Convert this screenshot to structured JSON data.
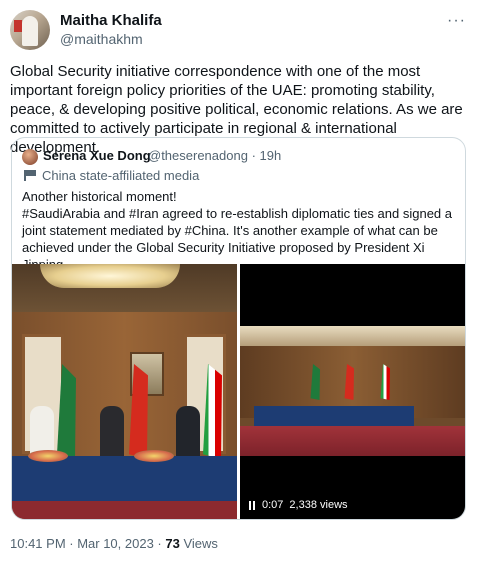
{
  "tweet": {
    "author_name": "Maitha Khalifa",
    "author_handle": "@maithakhm",
    "text": "Global Security initiative correspondence with one of the most important foreign policy priorities of the UAE: promoting stability, peace, & developing positive political, economic relations. As we are committed to actively participate in regional & international development.",
    "more_glyph": "···"
  },
  "quoted": {
    "author_name": "Serena Xue Dong",
    "author_handle": "@theserenadong",
    "time": "· 19h",
    "label": "China state-affiliated media",
    "text": "Another historical moment!\n#SaudiArabia and #Iran agreed to re-establish diplomatic ties and signed a joint statement mediated by #China. It's another example of what can be achieved under the Global Security Initiative proposed by President Xi Jinping.",
    "video": {
      "time": "0:07",
      "views": "2,338 views"
    }
  },
  "footer": {
    "timestamp": "10:41 PM · Mar 10, 2023 · ",
    "views_count": "73",
    "views_label": " Views"
  },
  "colors": {
    "text_primary": "#0f1419",
    "text_secondary": "#536471",
    "border": "#cfd9de"
  }
}
